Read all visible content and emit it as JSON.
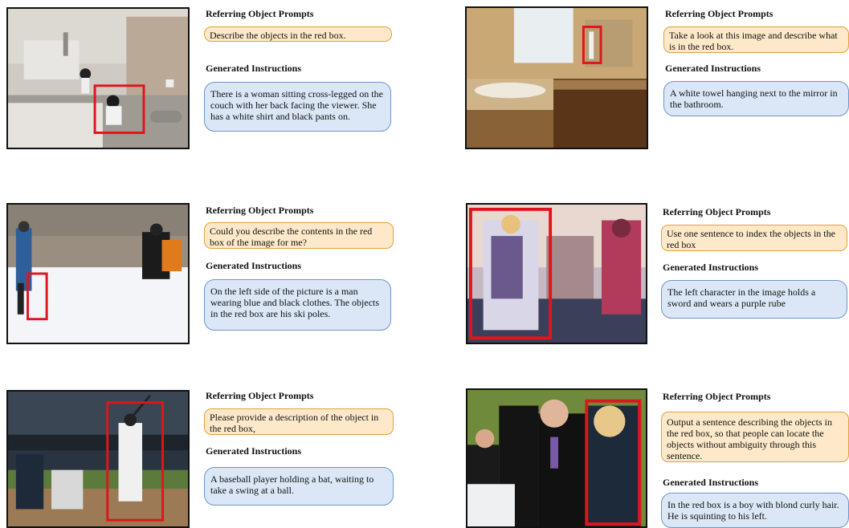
{
  "prompt_heading": "Referring Object Prompts",
  "instruction_heading": "Generated Instructions",
  "colors": {
    "prompt_fill": "#fde9c9",
    "prompt_border": "#e2a13b",
    "instruction_fill": "#dbe7f6",
    "instruction_border": "#6d95c8",
    "red_box": "#e0151b"
  },
  "examples": [
    {
      "scene": "living room with woman seated on couch",
      "prompt": "Describe the objects in the red box.",
      "instruction": "There is a woman sitting cross-legged on the couch with her back facing the viewer. She has a white shirt and black pants on."
    },
    {
      "scene": "bathroom with bathtub and towel by mirror",
      "prompt": "Take a look at this image and describe what is in the red box.",
      "instruction": "A white towel hanging next to the mirror in the bathroom."
    },
    {
      "scene": "snowy slope with skiers",
      "prompt": "Could you describe the contents in the red box of the image for me?",
      "instruction": "On the left side of the picture is a man wearing blue and black clothes. The objects in the red box are his ski poles."
    },
    {
      "scene": "fantasy game characters",
      "prompt": "Use one sentence to index the objects in the red box",
      "instruction": "The left character in the image holds a sword and wears a purple rube"
    },
    {
      "scene": "baseball batter at home plate",
      "prompt": "Please provide a description of the object in the red box,",
      "instruction": "A baseball player holding a bat, waiting to take a swing at a ball."
    },
    {
      "scene": "group of young people in suits",
      "prompt": "Output a sentence describing the objects in the red box, so that people can locate the objects without ambiguity through this sentence.",
      "instruction": "In the red box is a boy with blond curly hair. He is squinting to his left."
    }
  ]
}
